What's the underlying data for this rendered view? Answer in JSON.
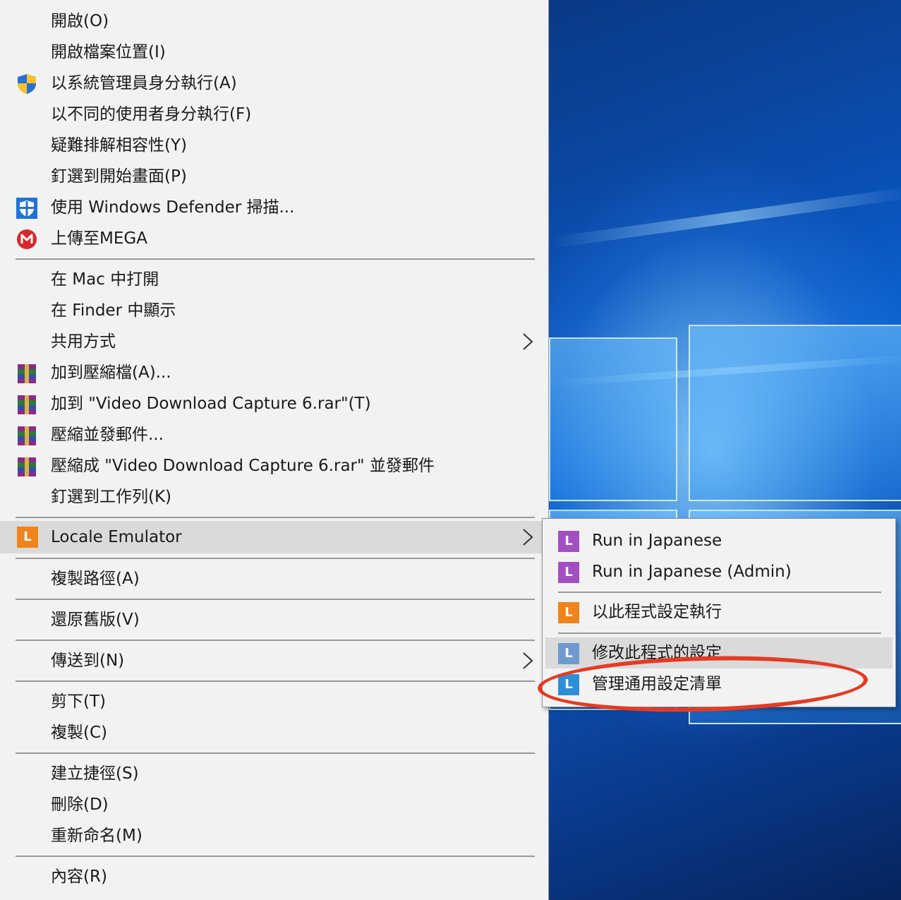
{
  "menu": {
    "items": [
      {
        "label": "開啟(O)"
      },
      {
        "label": "開啟檔案位置(I)"
      },
      {
        "label": "以系統管理員身分執行(A)",
        "icon": "uac-shield-icon"
      },
      {
        "label": "以不同的使用者身分執行(F)"
      },
      {
        "label": "疑難排解相容性(Y)"
      },
      {
        "label": "釘選到開始畫面(P)"
      },
      {
        "label": "使用 Windows Defender 掃描...",
        "icon": "windows-defender-icon"
      },
      {
        "label": "上傳至MEGA",
        "icon": "mega-icon"
      },
      {
        "label": "在 Mac 中打開"
      },
      {
        "label": "在 Finder 中顯示"
      },
      {
        "label": "共用方式"
      },
      {
        "label": "加到壓縮檔(A)...",
        "icon": "winrar-icon"
      },
      {
        "label": "加到 \"Video Download Capture 6.rar\"(T)",
        "icon": "winrar-icon"
      },
      {
        "label": "壓縮並發郵件...",
        "icon": "winrar-icon"
      },
      {
        "label": "壓縮成 \"Video Download Capture 6.rar\" 並發郵件",
        "icon": "winrar-icon"
      },
      {
        "label": "釘選到工作列(K)"
      },
      {
        "label": "Locale Emulator",
        "icon": "locale-emulator-icon",
        "icon_letter": "L"
      },
      {
        "label": "複製路徑(A)"
      },
      {
        "label": "還原舊版(V)"
      },
      {
        "label": "傳送到(N)"
      },
      {
        "label": "剪下(T)"
      },
      {
        "label": "複製(C)"
      },
      {
        "label": "建立捷徑(S)"
      },
      {
        "label": "刪除(D)"
      },
      {
        "label": "重新命名(M)"
      },
      {
        "label": "內容(R)"
      }
    ]
  },
  "submenu": {
    "items": [
      {
        "label": "Run in Japanese",
        "icon_letter": "L",
        "color": "#a24fc2"
      },
      {
        "label": "Run in Japanese (Admin)",
        "icon_letter": "L",
        "color": "#a24fc2"
      },
      {
        "label": "以此程式設定執行",
        "icon_letter": "L",
        "color": "#f0841c"
      },
      {
        "label": "修改此程式的設定",
        "icon_letter": "L",
        "color": "#6f9ad0"
      },
      {
        "label": "管理通用設定清單",
        "icon_letter": "L",
        "color": "#2f8fd6"
      }
    ]
  },
  "colors": {
    "annotation": "#e53a23",
    "highlight": "#dadada",
    "menu_bg": "#f2f2f2"
  }
}
